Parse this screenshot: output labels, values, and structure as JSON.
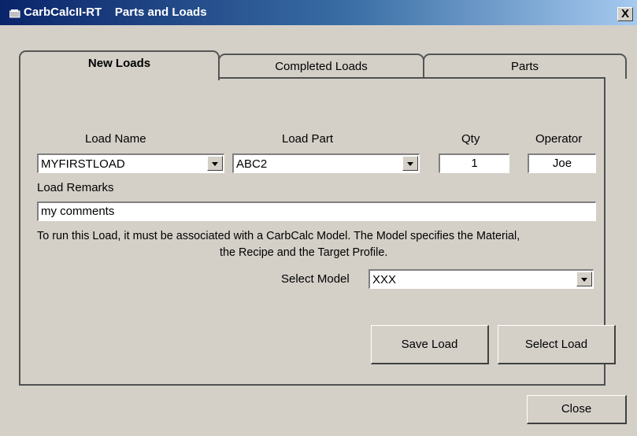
{
  "window": {
    "title_app": "CarbCalcII-RT",
    "title_page": "Parts and Loads",
    "close_glyph": "X"
  },
  "tabs": [
    {
      "label": "New Loads",
      "active": true
    },
    {
      "label": "Completed Loads",
      "active": false
    },
    {
      "label": "Parts",
      "active": false
    }
  ],
  "form": {
    "load_name_label": "Load Name",
    "load_name_value": "MYFIRSTLOAD",
    "load_part_label": "Load Part",
    "load_part_value": "ABC2",
    "qty_label": "Qty",
    "qty_value": "1",
    "operator_label": "Operator",
    "operator_value": "Joe",
    "remarks_label": "Load Remarks",
    "remarks_value": "my comments",
    "info_line1": "To run this Load, it must be associated with a CarbCalc Model.  The Model specifies the Material,",
    "info_line2": "the Recipe and the Target Profile.",
    "select_model_label": "Select Model",
    "select_model_value": "XXX"
  },
  "buttons": {
    "save_load": "Save Load",
    "select_load": "Select Load",
    "close": "Close"
  },
  "colors": {
    "titlebar_start": "#0a246a",
    "titlebar_end": "#a6caf0",
    "face": "#d4d0c8"
  }
}
